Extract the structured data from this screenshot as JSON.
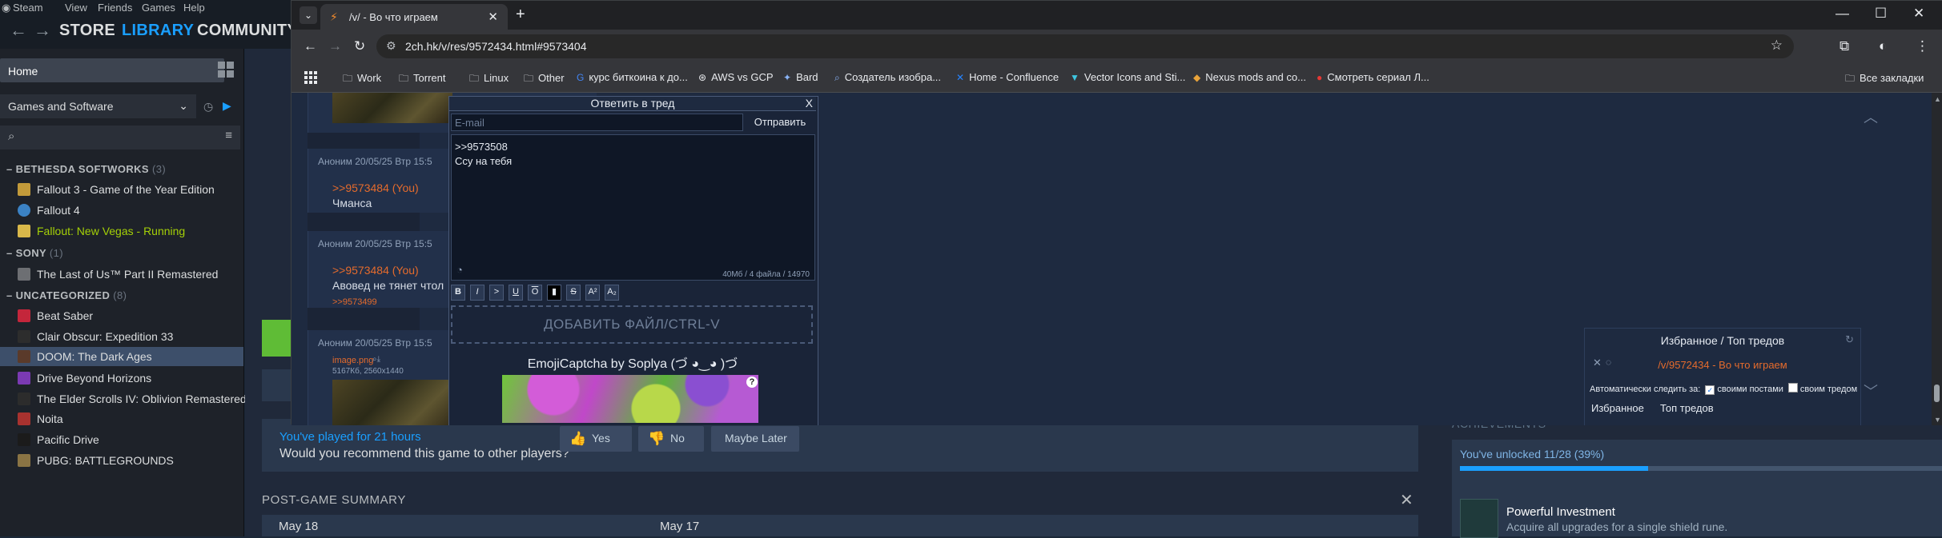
{
  "steam": {
    "menu": [
      "Steam",
      "View",
      "Friends",
      "Games",
      "Help"
    ],
    "nav": {
      "store": "STORE",
      "library": "LIBRARY",
      "community": "COMMUNITY"
    },
    "sidebar": {
      "home": "Home",
      "filter": "Games and Software",
      "categories": [
        {
          "name": "BETHESDA SOFTWORKS",
          "count": "(3)"
        },
        {
          "name": "SONY",
          "count": "(1)"
        },
        {
          "name": "UNCATEGORIZED",
          "count": "(8)"
        }
      ],
      "games": [
        {
          "name": "Fallout 3 - Game of the Year Edition",
          "color": "#c29a3a"
        },
        {
          "name": "Fallout 4",
          "color": "#3b82c4"
        },
        {
          "name": "Fallout: New Vegas",
          "status": " - Running",
          "color": "#d9b84a"
        },
        {
          "name": "The Last of Us™ Part II Remastered",
          "color": "#6d6f73"
        },
        {
          "name": "Beat Saber",
          "color": "#c4263b"
        },
        {
          "name": "Clair Obscur: Expedition 33",
          "color": "#2d2d2d"
        },
        {
          "name": "DOOM: The Dark Ages",
          "color": "#5a3a2a"
        },
        {
          "name": "Drive Beyond Horizons",
          "color": "#7b3ab3"
        },
        {
          "name": "The Elder Scrolls IV: Oblivion Remastered",
          "color": "#2c2c2c"
        },
        {
          "name": "Noita",
          "color": "#a8322f"
        },
        {
          "name": "Pacific Drive",
          "color": "#1b1b1b"
        },
        {
          "name": "PUBG: BATTLEGROUNDS",
          "color": "#8a7444"
        }
      ]
    },
    "review": {
      "played": "You've played for 21 hours",
      "question": "Would you recommend this game to other players?",
      "yes": "Yes",
      "no": "No",
      "later": "Maybe Later"
    },
    "post_game": {
      "title": "POST-GAME SUMMARY",
      "dates": [
        "May 18",
        "May 17"
      ]
    },
    "achievements": {
      "title": "ACHIEVEMENTS",
      "unlocked": "You've unlocked 11/28 (39%)",
      "progress": 0.39,
      "name": "Powerful Investment",
      "desc": "Acquire all upgrades for a single shield rune."
    }
  },
  "browser": {
    "tab_title": "/v/ - Во что играем",
    "url": "2ch.hk/v/res/9572434.html#9573404",
    "bookmarks": [
      {
        "label": "Work",
        "icon": "folder-icon"
      },
      {
        "label": "Torrent",
        "icon": "folder-icon"
      },
      {
        "label": "Linux",
        "icon": "folder-icon"
      },
      {
        "label": "Other",
        "icon": "folder-icon"
      },
      {
        "label": "курс биткоина к до...",
        "icon": "google-icon"
      },
      {
        "label": "AWS vs GCP",
        "icon": "chatgpt-icon"
      },
      {
        "label": "Bard",
        "icon": "bard-icon"
      },
      {
        "label": "Создатель изобра...",
        "icon": "search-icon"
      },
      {
        "label": "Home - Confluence",
        "icon": "confluence-icon"
      },
      {
        "label": "Vector Icons and Sti...",
        "icon": "vector-icon"
      },
      {
        "label": "Nexus mods and co...",
        "icon": "nexus-icon"
      },
      {
        "label": "Смотреть сериал Л...",
        "icon": "video-icon"
      }
    ],
    "all_bookmarks": "Все закладки"
  },
  "thread": {
    "posts": [
      {
        "header": "Аноним  20/05/25 Втр 15:5",
        "reply": ">>9573484 (You)",
        "text": "Чманса"
      },
      {
        "header": "Аноним  20/05/25 Втр 15:5",
        "reply": ">>9573484 (You)",
        "text": "Авовед не тянет чтол",
        "backref": ">>9573499"
      },
      {
        "header": "Аноним  20/05/25 Втр 15:5",
        "file": "image.png",
        "file_info": "5167Кб, 2560x1440"
      }
    ]
  },
  "reply_form": {
    "title": "Ответить в тред",
    "close": "X",
    "email_placeholder": "E-mail",
    "send": "Отправить",
    "text_line1": ">>9573508",
    "text_line2": "Ссу на тебя",
    "meta": "40Мб / 4 файла / 14970",
    "tools": [
      "B",
      "I",
      ">",
      "U",
      "O",
      "▮",
      "S",
      "A²",
      "A₂"
    ],
    "drop": "ДОБАВИТЬ ФАЙЛ/CTRL-V",
    "captcha": "EmojiCaptcha by Soplya (づ ◕‿◕ )づ",
    "captcha_help": "?"
  },
  "favorites": {
    "title": "Избранное / Топ тредов",
    "link": "/v/9572434 - Во что играем",
    "auto_label": "Автоматически следить за:",
    "opt1": "своими постами",
    "opt2": "своим тредом",
    "tab1": "Избранное",
    "tab2": "Топ тредов"
  }
}
